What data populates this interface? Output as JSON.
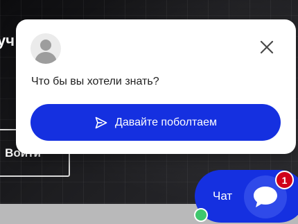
{
  "background": {
    "partial_text": "уч",
    "login_button_label": "Войти"
  },
  "chat_popup": {
    "question": "Что бы вы хотели знать?",
    "cta_label": "Давайте поболтаем",
    "close_icon": "close-icon",
    "avatar_icon": "user-avatar-icon",
    "send_icon": "send-icon"
  },
  "chat_launcher": {
    "label": "Чат",
    "unread_count": "1",
    "chat_icon": "chat-bubble-icon",
    "online": true
  },
  "colors": {
    "accent": "#1530e0",
    "badge": "#d0021b",
    "status_online": "#3ec76d"
  }
}
